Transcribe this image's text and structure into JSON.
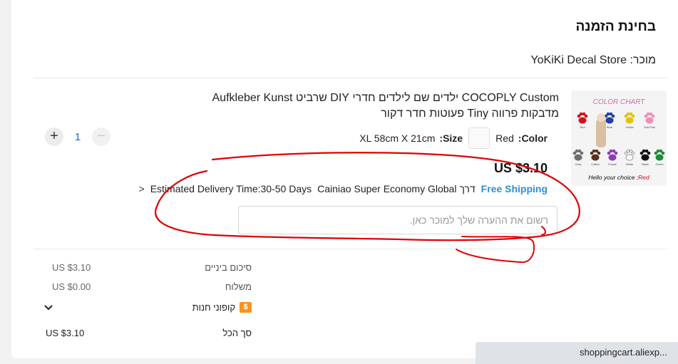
{
  "header": {
    "title": "בחינת הזמנה",
    "seller": "מוכר: YoKiKi Decal Store"
  },
  "product": {
    "title": "COCOPLY Custom ילדים שם לילדים חדרי DIY שרביט Aufkleber Kunst מדבקות פרווה Tiny פעוטות חדר דקור",
    "thumbnail": {
      "heading": "COLOR CHART",
      "caption_prefix": "Hello your choice :",
      "caption_choice": "Red",
      "swatches": [
        {
          "label": "Red",
          "color": "#d0101b"
        },
        {
          "label": "Blue",
          "color": "#1e3ea8"
        },
        {
          "label": "Yellow",
          "color": "#e3c20c"
        },
        {
          "label": "Soft Pink",
          "color": "#f08cb4"
        },
        {
          "label": "Grey",
          "color": "#6e6e6e"
        },
        {
          "label": "Coffee",
          "color": "#5a3220"
        },
        {
          "label": "Purple",
          "color": "#8e3bb5"
        },
        {
          "label": "White",
          "color": "#ffffff"
        },
        {
          "label": "Black",
          "color": "#111111"
        },
        {
          "label": "Green",
          "color": "#1f8a3a"
        }
      ]
    },
    "color_label": "Color:",
    "color_value": "Red",
    "size_label": "Size:",
    "size_value": "XL 58cm X 21cm",
    "price": "US $3.10",
    "quantity": "1",
    "minus_label": "−",
    "plus_label": "+",
    "shipping": {
      "free_label": "Free Shipping",
      "service": "דרך Cainiao Super Economy Global",
      "estimate": "Estimated Delivery Time:30-50 Days",
      "chevron": "<"
    },
    "note_placeholder": "רשום את ההערה שלך למוכר כאן."
  },
  "summary": {
    "subtotal_label": "סיכום ביניים",
    "subtotal_value": "US $3.10",
    "shipping_label": "משלוח",
    "shipping_value": "US $0.00",
    "coupon_label": "קופוני חנות",
    "coupon_badge": "$",
    "total_label": "סך הכל",
    "total_value": "US $3.10"
  },
  "statusbar": {
    "url": "shoppingcart.aliexp..."
  },
  "colors": {
    "accent_blue": "#2b8fd6",
    "coupon_orange": "#f7931e",
    "annotation_red": "#e00000"
  }
}
